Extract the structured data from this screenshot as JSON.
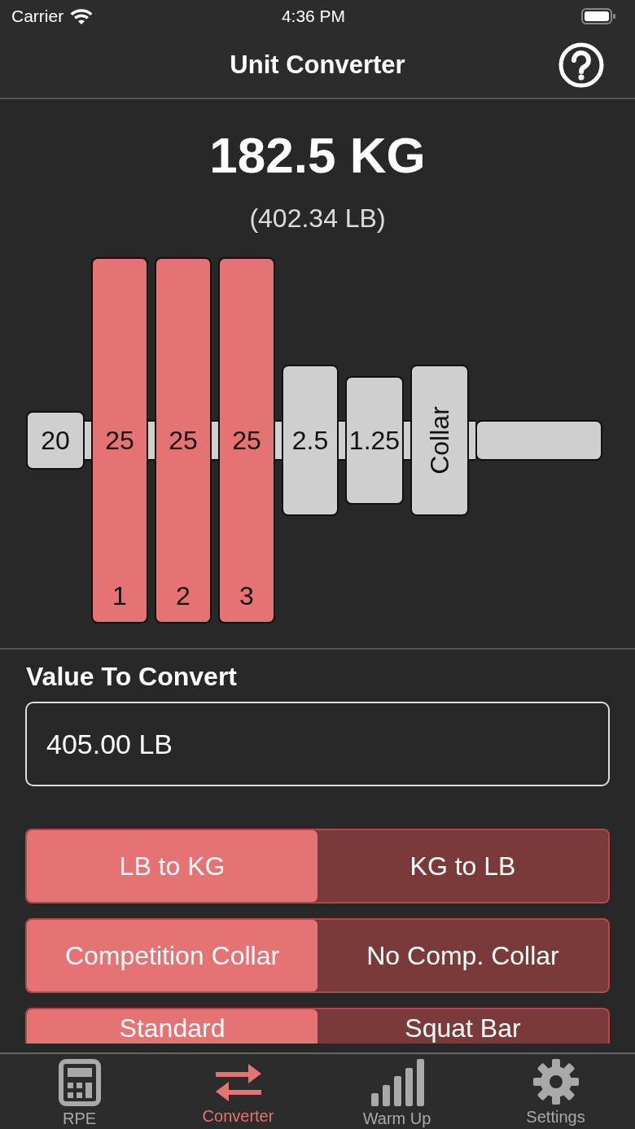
{
  "status_bar": {
    "carrier": "Carrier",
    "time": "4:36 PM"
  },
  "nav": {
    "title": "Unit Converter"
  },
  "result": {
    "main": "182.5 KG",
    "secondary": "(402.34 LB)"
  },
  "plates": [
    {
      "kind": "bar",
      "label": "20",
      "color": "#cfcfcf"
    },
    {
      "kind": "large",
      "label": "25",
      "index": "1",
      "color": "#e57373"
    },
    {
      "kind": "large",
      "label": "25",
      "index": "2",
      "color": "#e57373"
    },
    {
      "kind": "large",
      "label": "25",
      "index": "3",
      "color": "#e57373"
    },
    {
      "kind": "medium",
      "label": "2.5",
      "color": "#cfcfcf"
    },
    {
      "kind": "small",
      "label": "1.25",
      "color": "#cfcfcf"
    },
    {
      "kind": "collar",
      "label": "Collar",
      "color": "#cfcfcf"
    }
  ],
  "input": {
    "label": "Value To Convert",
    "value": "405.00 LB"
  },
  "toggles": [
    [
      {
        "label": "LB to KG",
        "selected": true
      },
      {
        "label": "KG to LB",
        "selected": false
      }
    ],
    [
      {
        "label": "Competition Collar",
        "selected": true
      },
      {
        "label": "No Comp. Collar",
        "selected": false
      }
    ],
    [
      {
        "label": "Standard",
        "selected": true
      },
      {
        "label": "Squat Bar",
        "selected": false
      }
    ]
  ],
  "tabs": [
    {
      "label": "RPE",
      "selected": false
    },
    {
      "label": "Converter",
      "selected": true
    },
    {
      "label": "Warm Up",
      "selected": false
    },
    {
      "label": "Settings",
      "selected": false
    }
  ]
}
